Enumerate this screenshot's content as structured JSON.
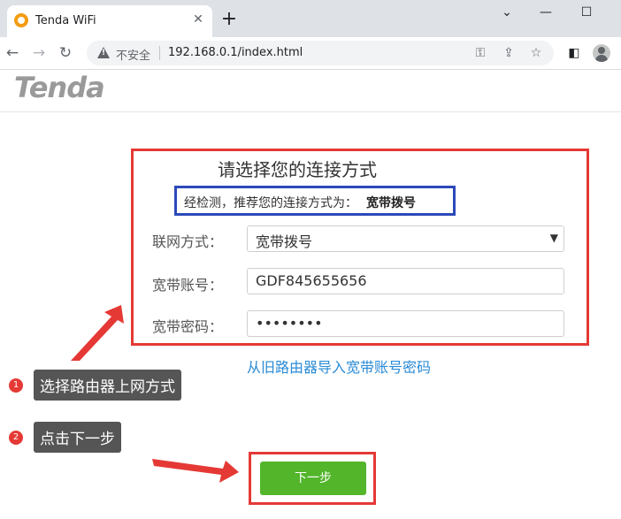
{
  "browser": {
    "tab_title": "Tenda WiFi",
    "new_tab": "+",
    "insecure_label": "不安全",
    "url": "192.168.0.1/index.html"
  },
  "page": {
    "logo": "Tenda",
    "title": "请选择您的连接方式",
    "recommend_prefix": "经检测，推荐您的连接方式为：",
    "recommend_value": "宽带拨号",
    "fields": {
      "mode_label": "联网方式：",
      "mode_value": "宽带拨号",
      "account_label": "宽带账号：",
      "account_value": "GDF845655656",
      "password_label": "宽带密码：",
      "password_value": "••••••••"
    },
    "import_link": "从旧路由器导入宽带账号密码",
    "next_button": "下一步"
  },
  "annotations": {
    "step1_number": "1",
    "step1_text": "选择路由器上网方式",
    "step2_number": "2",
    "step2_text": "点击下一步"
  },
  "colors": {
    "highlight_red": "#e53935",
    "highlight_blue": "#2c49b8",
    "button_green": "#52b52a",
    "link_blue": "#2a8bd6"
  }
}
